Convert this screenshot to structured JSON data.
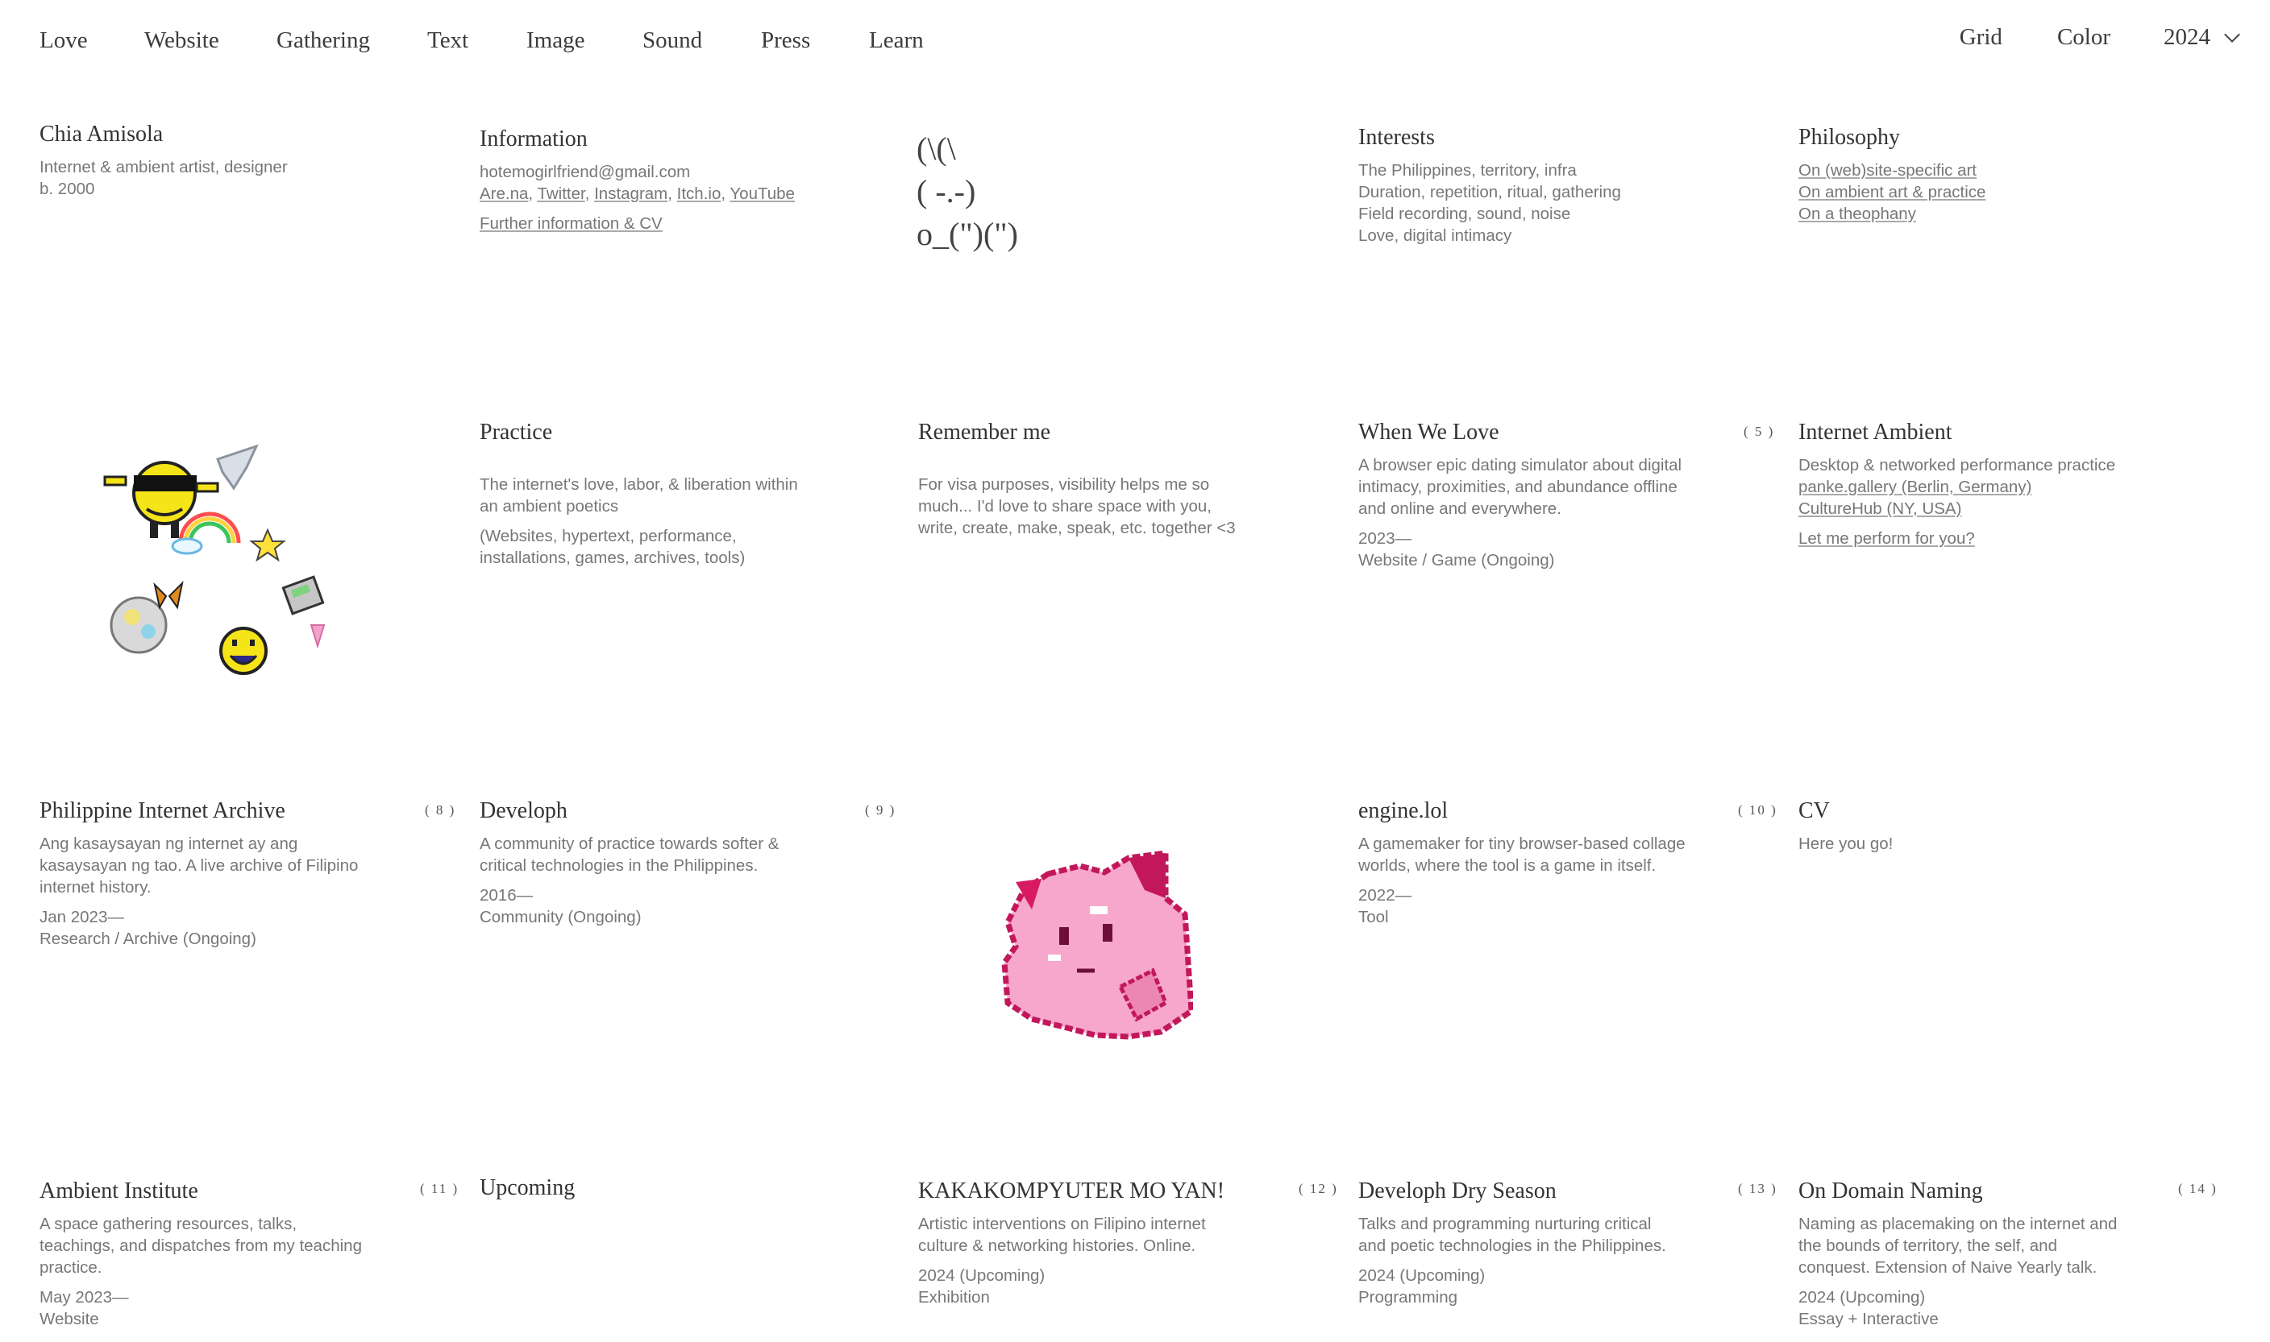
{
  "nav": {
    "items": [
      "Love",
      "Website",
      "Gathering",
      "Text",
      "Image",
      "Sound",
      "Press",
      "Learn"
    ],
    "right": {
      "grid": "Grid",
      "color": "Color",
      "year": "2024"
    }
  },
  "profile": {
    "name": "Chia Amisola",
    "role": "Internet & ambient artist, designer",
    "born": "b. 2000"
  },
  "information": {
    "title": "Information",
    "email": "hotemogirlfriend@gmail.com",
    "links": [
      "Are.na",
      "Twitter",
      "Instagram",
      "Itch.io",
      "YouTube"
    ],
    "more": "Further information & CV"
  },
  "ascii_art": [
    "(\\(\\",
    "( -.-)",
    "o_(\")(\")"
  ],
  "interests": {
    "title": "Interests",
    "lines": [
      "The Philippines, territory, infra",
      "Duration, repetition, ritual, gathering",
      "Field recording, sound, noise",
      "Love, digital intimacy"
    ]
  },
  "philosophy": {
    "title": "Philosophy",
    "links": [
      "On (web)site-specific art",
      "On ambient art & practice",
      "On a theophany"
    ]
  },
  "practice": {
    "title": "Practice",
    "lines": [
      "The internet's love, labor, & liberation within",
      "an ambient poetics"
    ],
    "lines2": [
      "(Websites, hypertext, performance,",
      "installations, games, archives, tools)"
    ]
  },
  "remember": {
    "title": "Remember me",
    "lines": [
      "For visa purposes, visibility helps me so",
      "much... I'd love to share space with you,",
      "write, create, make, speak, etc. together <3"
    ]
  },
  "projects": [
    {
      "title": "When We Love",
      "num": "( 5 )",
      "desc": [
        "A browser epic dating simulator about digital",
        "intimacy, proximities, and abundance offline",
        "and online and everywhere."
      ],
      "date": "2023—",
      "type": "Website / Game (Ongoing)"
    },
    {
      "title": "Internet Ambient",
      "desc": [
        "Desktop & networked performance practice"
      ],
      "links": [
        "panke.gallery (Berlin, Germany)",
        "CultureHub (NY, USA)"
      ],
      "cta": "Let me perform for you?"
    },
    {
      "title": "Philippine Internet Archive",
      "num": "( 8 )",
      "desc": [
        "Ang kasaysayan ng internet ay ang",
        "kasaysayan ng tao. A live archive of Filipino",
        "internet history."
      ],
      "date": "Jan 2023—",
      "type": "Research / Archive (Ongoing)"
    },
    {
      "title": "Developh",
      "num": "( 9 )",
      "desc": [
        "A community of practice towards softer &",
        "critical technologies in the Philippines."
      ],
      "date": "2016—",
      "type": "Community (Ongoing)"
    },
    {
      "title": "engine.lol",
      "num": "( 10 )",
      "desc": [
        "A gamemaker for tiny browser-based collage",
        "worlds, where the tool is a game in itself."
      ],
      "date": "2022—",
      "type": "Tool"
    },
    {
      "title": "CV",
      "desc": [
        "Here you go!"
      ]
    },
    {
      "title": "Ambient Institute",
      "num": "( 11 )",
      "desc": [
        "A space gathering resources, talks,",
        "teachings, and dispatches from my teaching",
        "practice."
      ],
      "date": "May 2023—",
      "type": "Website"
    },
    {
      "title": "Upcoming"
    },
    {
      "title": "KAKAKOMPYUTER MO YAN!",
      "num": "( 12 )",
      "desc": [
        "Artistic interventions on Filipino internet",
        "culture & networking histories. Online."
      ],
      "date": "2024 (Upcoming)",
      "type": "Exhibition"
    },
    {
      "title": "Developh Dry Season",
      "num": "( 13 )",
      "desc": [
        "Talks and programming nurturing critical",
        "and poetic technologies in the Philippines."
      ],
      "date": "2024 (Upcoming)",
      "type": "Programming"
    },
    {
      "title": "On Domain Naming",
      "num": "( 14 )",
      "desc": [
        "Naming as placemaking on the internet and",
        "the bounds of territory, the self, and",
        "conquest. Extension of Naive Yearly talk."
      ],
      "date": "2024 (Upcoming)",
      "type": "Essay + Interactive"
    }
  ],
  "colors": {
    "text": "#333333",
    "muted": "#777777",
    "pink": "#f4a0c8",
    "magenta": "#c8186a",
    "yellow": "#f5e418"
  }
}
